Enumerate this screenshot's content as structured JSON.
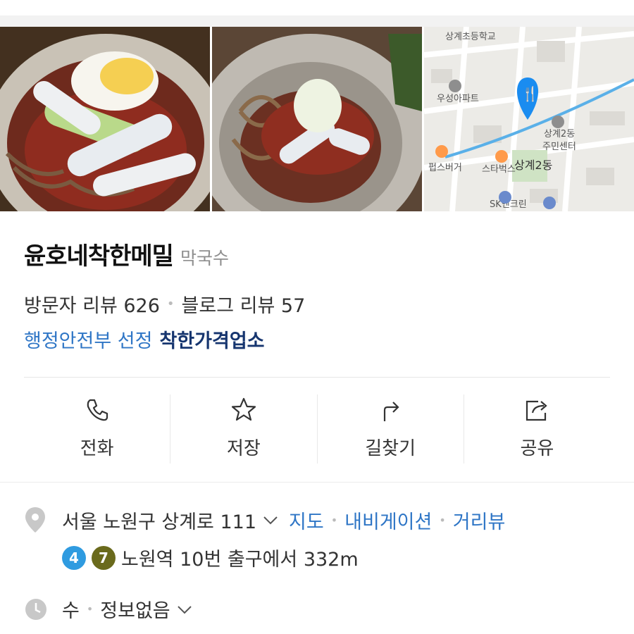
{
  "photos": {
    "photo1_alt": "",
    "photo2_alt": "",
    "map": {
      "labels": [
        "상계초등학교",
        "우성아파트",
        "상계2동 주민센터",
        "펍스버거",
        "스타벅스",
        "상계2동",
        "SK엔크린"
      ]
    }
  },
  "place": {
    "name": "윤호네착한메밀",
    "category": "막국수"
  },
  "reviews": {
    "visitor": "방문자 리뷰 626",
    "blog": "블로그 리뷰 57"
  },
  "certified": {
    "prefix": "행정안전부 선정",
    "badge": "착한가격업소"
  },
  "actions": {
    "call": "전화",
    "save": "저장",
    "directions": "길찾기",
    "share": "공유"
  },
  "address": {
    "text": "서울 노원구 상계로 111",
    "map_link": "지도",
    "navi_link": "내비게이션",
    "street_link": "거리뷰"
  },
  "station": {
    "line1": "4",
    "line1_color": "#2f9be0",
    "line2": "7",
    "line2_color": "#6a6a1c",
    "text": "노원역 10번 출구에서 332m"
  },
  "hours": {
    "day": "수",
    "status": "정보없음"
  },
  "colors": {
    "link": "#2f76c6",
    "badge_dark": "#16356f",
    "map_pin": "#1a8cf0"
  }
}
